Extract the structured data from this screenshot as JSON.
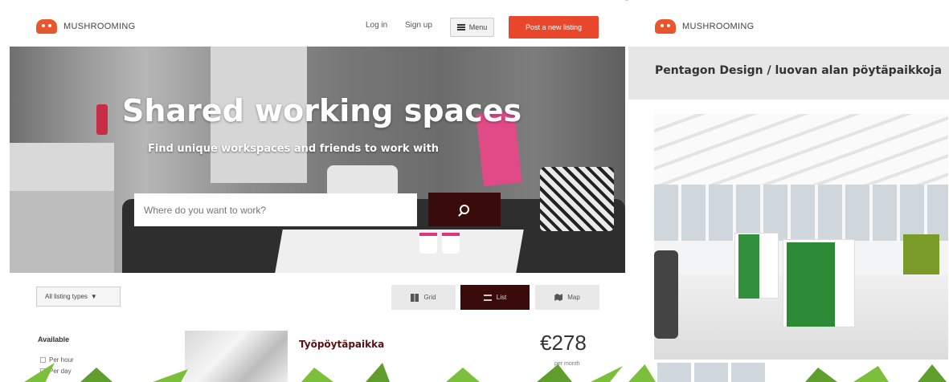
{
  "left": {
    "brand": "MUSHROOMING",
    "nav": {
      "login": "Log in",
      "signup": "Sign up",
      "menu": "Menu",
      "post": "Post a new listing"
    },
    "hero": {
      "title": "Shared working spaces",
      "subtitle": "Find unique workspaces and friends to work with",
      "search_placeholder": "Where do you want to work?"
    },
    "filters": {
      "listing_types": "All listing types"
    },
    "views": {
      "grid": "Grid",
      "list": "List",
      "map": "Map"
    },
    "sidebar": {
      "available_label": "Available",
      "options": [
        "Per hour",
        "Per day"
      ]
    },
    "listing": {
      "title": "Työpöytäpaikka",
      "price": "€278",
      "per": "per month"
    }
  },
  "right": {
    "brand": "MUSHROOMING",
    "title": "Pentagon Design / luovan alan pöytäpaikkoja"
  },
  "colors": {
    "accent": "#e8472b",
    "dark_maroon": "#3a0b0b",
    "leaf_green": "#7bbf3a"
  }
}
